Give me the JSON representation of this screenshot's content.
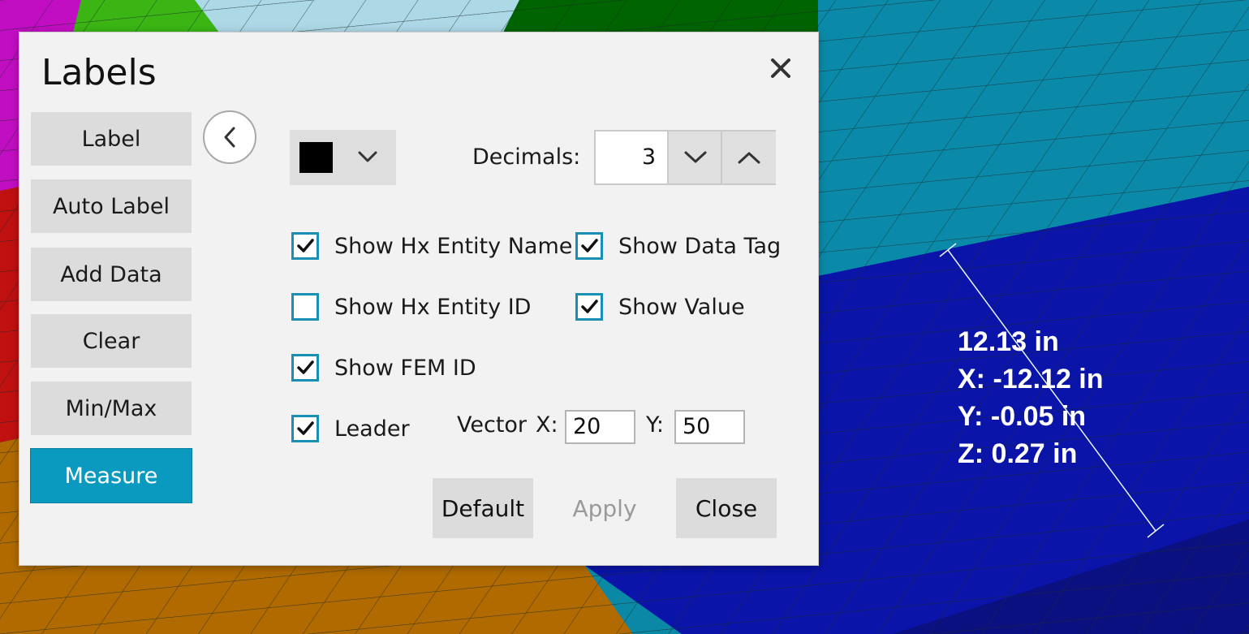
{
  "dialog": {
    "title": "Labels"
  },
  "sidebar": {
    "items": [
      {
        "label": "Label"
      },
      {
        "label": "Auto Label"
      },
      {
        "label": "Add Data"
      },
      {
        "label": "Clear"
      },
      {
        "label": "Min/Max"
      },
      {
        "label": "Measure",
        "active": true
      }
    ]
  },
  "options": {
    "color": "#000000",
    "decimals_label": "Decimals:",
    "decimals_value": "3",
    "checkboxes": [
      {
        "label": "Show Hx Entity Name",
        "checked": true
      },
      {
        "label": "Show Data Tag",
        "checked": true
      },
      {
        "label": "Show Hx Entity ID",
        "checked": false
      },
      {
        "label": "Show Value",
        "checked": true
      },
      {
        "label": "Show FEM ID",
        "checked": true
      },
      {
        "label": "Leader",
        "checked": true
      }
    ],
    "vector_label": "Vector",
    "vector_x_label": "X:",
    "vector_x_value": "20",
    "vector_y_label": "Y:",
    "vector_y_value": "50"
  },
  "footer": {
    "default_label": "Default",
    "apply_label": "Apply",
    "close_label": "Close"
  },
  "viewport": {
    "measurement": {
      "distance": "12.13 in",
      "x": "X: -12.12 in",
      "y": "Y: -0.05 in",
      "z": "Z: 0.27 in"
    }
  },
  "colors": {
    "accent": "#0a9ac0",
    "checkbox_border": "#1a8fb4",
    "mesh_cyan": "#0a8aa8",
    "mesh_blue": "#0a1aa8",
    "mesh_orange": "#b06a00",
    "mesh_green": "#006600"
  },
  "icons": [
    "close-icon",
    "chevron-left-icon",
    "chevron-down-icon",
    "chevron-up-icon",
    "check-icon"
  ]
}
